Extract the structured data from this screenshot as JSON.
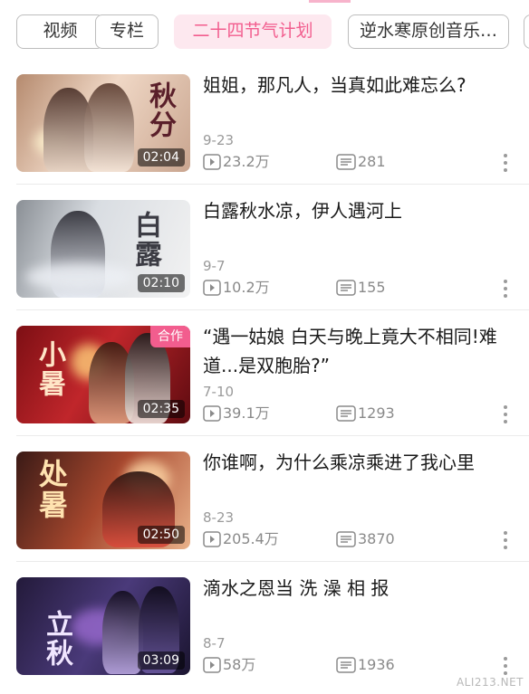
{
  "tabs": [
    {
      "label": "视频"
    },
    {
      "label": "专栏"
    },
    {
      "label": "二十四节气计划",
      "active": true
    },
    {
      "label": "逆水寒原创音乐…"
    }
  ],
  "videos": [
    {
      "title": "姐姐，那凡人，当真如此难忘么?",
      "date": "9-23",
      "plays": "23.2万",
      "comments": "281",
      "duration": "02:04",
      "thumb_text": "秋分"
    },
    {
      "title": "白露秋水凉，伊人遇河上",
      "date": "9-7",
      "plays": "10.2万",
      "comments": "155",
      "duration": "02:10",
      "thumb_text": "白露"
    },
    {
      "title": "“遇一姑娘  白天与晚上竟大不相同!难道...是双胞胎?”",
      "date": "7-10",
      "plays": "39.1万",
      "comments": "1293",
      "duration": "02:35",
      "badge": "合作",
      "thumb_text": "小暑"
    },
    {
      "title": "你谁啊，为什么乘凉乘进了我心里",
      "date": "8-23",
      "plays": "205.4万",
      "comments": "3870",
      "duration": "02:50",
      "thumb_text": "处暑"
    },
    {
      "title": "滴水之恩当  洗  澡  相  报",
      "date": "8-7",
      "plays": "58万",
      "comments": "1936",
      "duration": "03:09",
      "thumb_text": "立秋"
    }
  ],
  "icons": {
    "play": "play-count-icon",
    "comment": "comment-count-icon",
    "more": "more-vertical-icon"
  },
  "colors": {
    "accent": "#f25d8e",
    "accent_bg": "#fde8ef"
  },
  "watermark": "ALI213.NET"
}
